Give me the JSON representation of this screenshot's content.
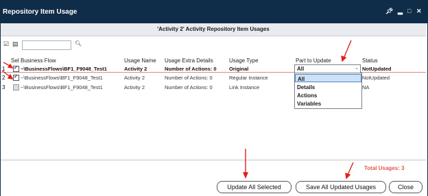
{
  "window": {
    "title": "Repository Item Usage"
  },
  "subtitle": "'Activity 2' Activity Repository Item Usages",
  "search": {
    "placeholder": ""
  },
  "columns": [
    "Sel",
    "Business Flow",
    "Usage Name",
    "Usage Extra Details",
    "Usage Type",
    "Part to Update",
    "Status"
  ],
  "rows": [
    {
      "num": "1",
      "checked": true,
      "flow": "~\\BusinessFlows\\BF1_F9048_Test1",
      "usage_name": "Activity 2",
      "extra": "Number of Actions: 0",
      "type": "Original",
      "part": "All",
      "status": "NotUpdated"
    },
    {
      "num": "2",
      "checked": true,
      "flow": "~\\BusinessFlows\\BF1_F9048_Test1",
      "usage_name": "Activity 2",
      "extra": "Number of Actions: 0",
      "type": "Regular Instance",
      "part": "",
      "status": "NotUpdated"
    },
    {
      "num": "3",
      "checked": false,
      "flow": "~\\BusinessFlows\\BF1_F9048_Test1",
      "usage_name": "Activity 2",
      "extra": "Number of Actions: 0",
      "type": "Link Instance",
      "part": "",
      "status": "NA"
    }
  ],
  "dropdown_options": [
    "All",
    "Details",
    "Actions",
    "Variables"
  ],
  "total": {
    "label": "Total Usages:",
    "value": "3"
  },
  "buttons": {
    "update_selected": "Update All Selected",
    "save_updated": "Save All Updated Usages",
    "close": "Close"
  },
  "colors": {
    "titlebar": "#0f2c49",
    "total": "#e05a4f",
    "arrow": "#e0201a",
    "selected_option": "#cde2f7"
  }
}
